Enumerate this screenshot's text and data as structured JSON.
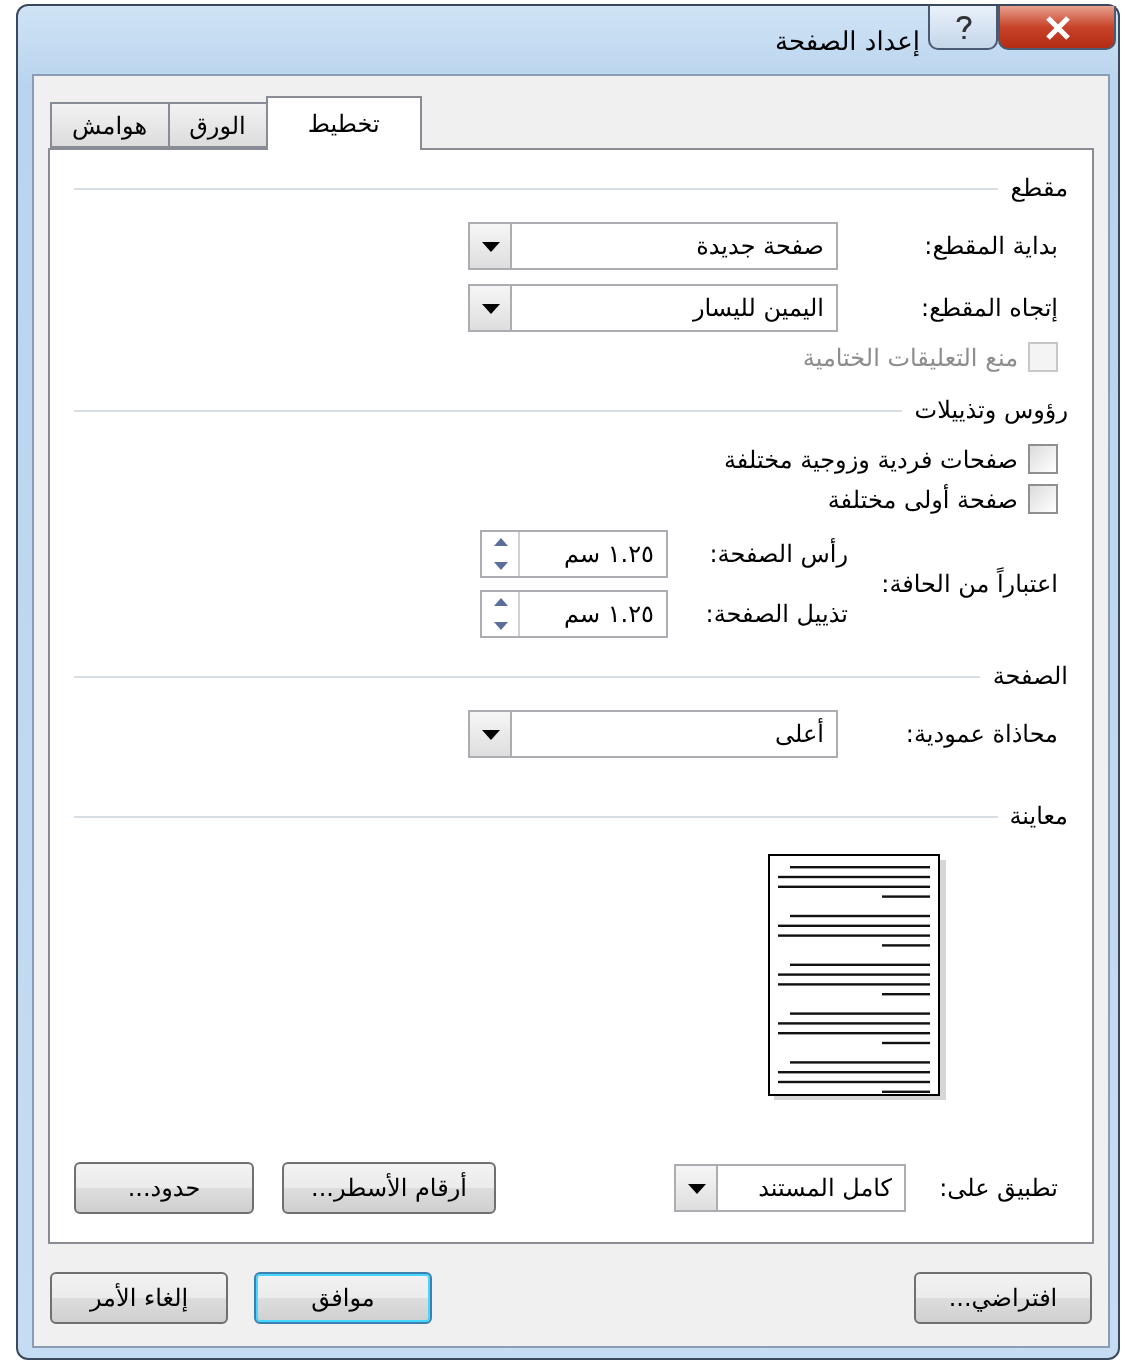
{
  "window": {
    "title": "إعداد الصفحة"
  },
  "tabs": [
    {
      "label": "تخطيط",
      "selected": true
    },
    {
      "label": "الورق",
      "selected": false
    },
    {
      "label": "هوامش",
      "selected": false
    }
  ],
  "section": {
    "title": "مقطع",
    "fields": [
      {
        "label": "بداية المقطع:",
        "value": "صفحة جديدة"
      },
      {
        "label": "إتجاه المقطع:",
        "value": "اليمين لليسار"
      }
    ],
    "checkbox": {
      "label": "منع التعليقات الختامية",
      "checked": false,
      "disabled": true
    }
  },
  "headers_footers": {
    "title": "رؤوس وتذييلات",
    "checkboxes": [
      {
        "label": "صفحات فردية وزوجية مختلفة",
        "checked": false,
        "disabled": false
      },
      {
        "label": "صفحة أولى مختلفة",
        "checked": false,
        "disabled": false
      }
    ],
    "from_edge_label": "اعتباراً من الحافة:",
    "spinners": [
      {
        "label": "رأس الصفحة:",
        "value": "١.٢٥ سم"
      },
      {
        "label": "تذييل الصفحة:",
        "value": "١.٢٥ سم"
      }
    ]
  },
  "page": {
    "title": "الصفحة",
    "field": {
      "label": "محاذاة عمودية:",
      "value": "أعلى"
    }
  },
  "preview": {
    "title": "معاينة"
  },
  "apply_to": {
    "label": "تطبيق على:",
    "value": "كامل المستند"
  },
  "panel_buttons": [
    "أرقام الأسطر...",
    "حدود..."
  ],
  "footer_buttons": [
    {
      "label": "افتراضي...",
      "kind": "plain"
    },
    {
      "label": "موافق",
      "kind": "primary"
    },
    {
      "label": "إلغاء الأمر",
      "kind": "plain"
    }
  ]
}
